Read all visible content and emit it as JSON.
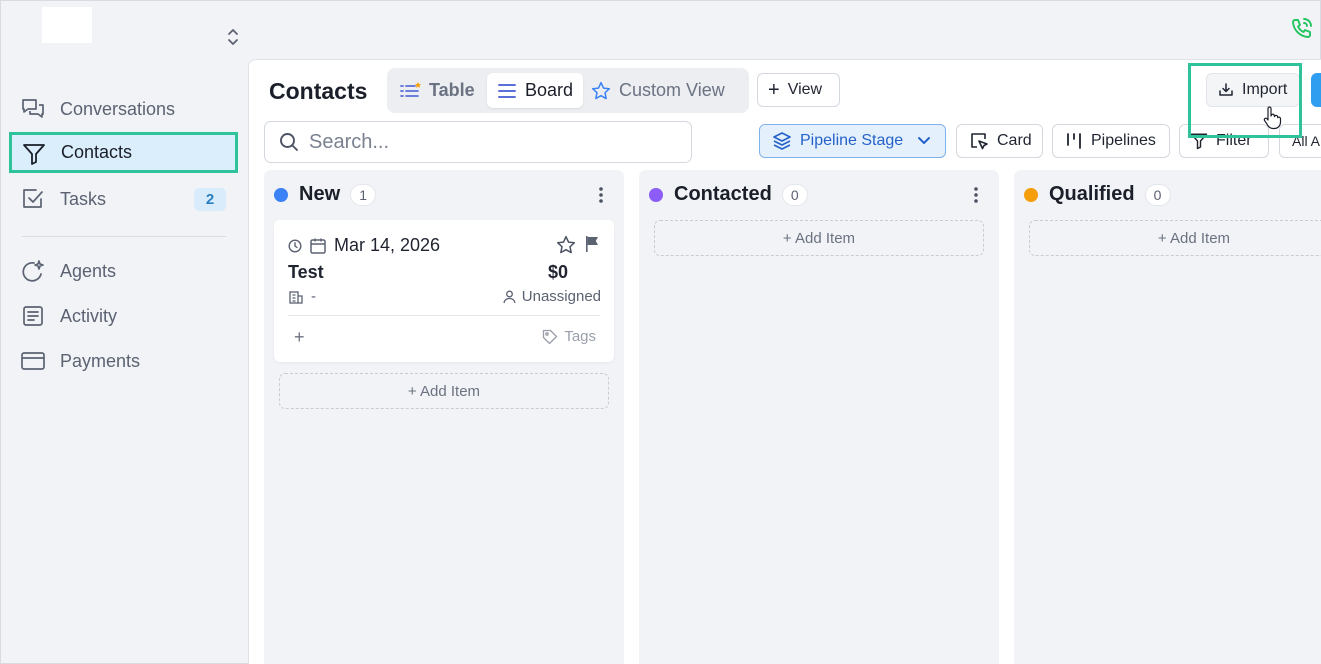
{
  "sidebar": {
    "items": [
      {
        "label": "Conversations",
        "icon": "chat-bubbles-icon"
      },
      {
        "label": "Contacts",
        "icon": "funnel-icon",
        "active": true
      },
      {
        "label": "Tasks",
        "icon": "checkbox-icon",
        "badge": "2"
      },
      {
        "label": "Agents",
        "icon": "sparkle-agent-icon"
      },
      {
        "label": "Activity",
        "icon": "document-list-icon"
      },
      {
        "label": "Payments",
        "icon": "credit-card-icon"
      }
    ]
  },
  "header": {
    "title": "Contacts",
    "tabs": [
      {
        "label": "Table",
        "icon": "list-icon"
      },
      {
        "label": "Board",
        "icon": "menu-lines-icon",
        "selected": true
      },
      {
        "label": "Custom View",
        "icon": "star-icon"
      }
    ],
    "view_button": "View",
    "import_button": "Import"
  },
  "toolbar": {
    "search_placeholder": "Search...",
    "pipeline_stage": "Pipeline Stage",
    "card": "Card",
    "pipelines": "Pipelines",
    "filter": "Filter",
    "all": "All A"
  },
  "board": {
    "columns": [
      {
        "name": "New",
        "count": "1",
        "color": "#3b82f6"
      },
      {
        "name": "Contacted",
        "count": "0",
        "color": "#8b5cf6"
      },
      {
        "name": "Qualified",
        "count": "0",
        "color": "#f59e0b"
      }
    ],
    "add_item": "+ Add Item",
    "card": {
      "date": "Mar 14, 2026",
      "title": "Test",
      "amount": "$0",
      "company": "-",
      "assignee": "Unassigned",
      "add": "+",
      "tags": "Tags"
    }
  },
  "colors": {
    "accent": "#2fc39b",
    "brand_blue": "#2f9ef0",
    "active_bg": "#dbeefb"
  }
}
